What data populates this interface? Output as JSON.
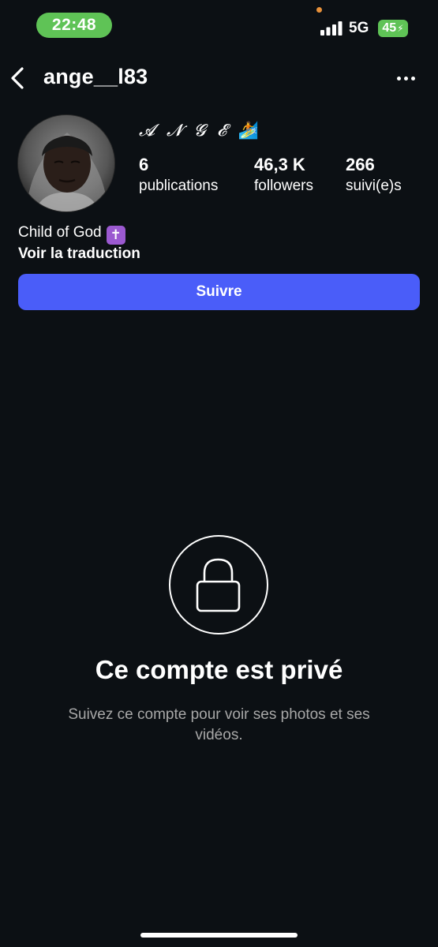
{
  "status_bar": {
    "time": "22:48",
    "network": "5G",
    "battery": "45"
  },
  "header": {
    "username": "ange__l83"
  },
  "profile": {
    "display_name": "𝓐 𝓝 𝓖 𝓔",
    "display_emoji": "🏄",
    "stats": {
      "posts": {
        "value": "6",
        "label": "publications"
      },
      "followers": {
        "value": "46,3 K",
        "label": "followers"
      },
      "following": {
        "value": "266",
        "label": "suivi(e)s"
      }
    },
    "bio": "Child of God",
    "bio_emoji": "✝",
    "translate_label": "Voir la traduction",
    "follow_label": "Suivre"
  },
  "private": {
    "title": "Ce compte est privé",
    "description": "Suivez ce compte pour voir ses photos et ses vidéos."
  },
  "colors": {
    "background": "#0c1014",
    "accent": "#4a5df9",
    "status_green": "#5fc356",
    "muted_text": "#a8a8a8"
  }
}
